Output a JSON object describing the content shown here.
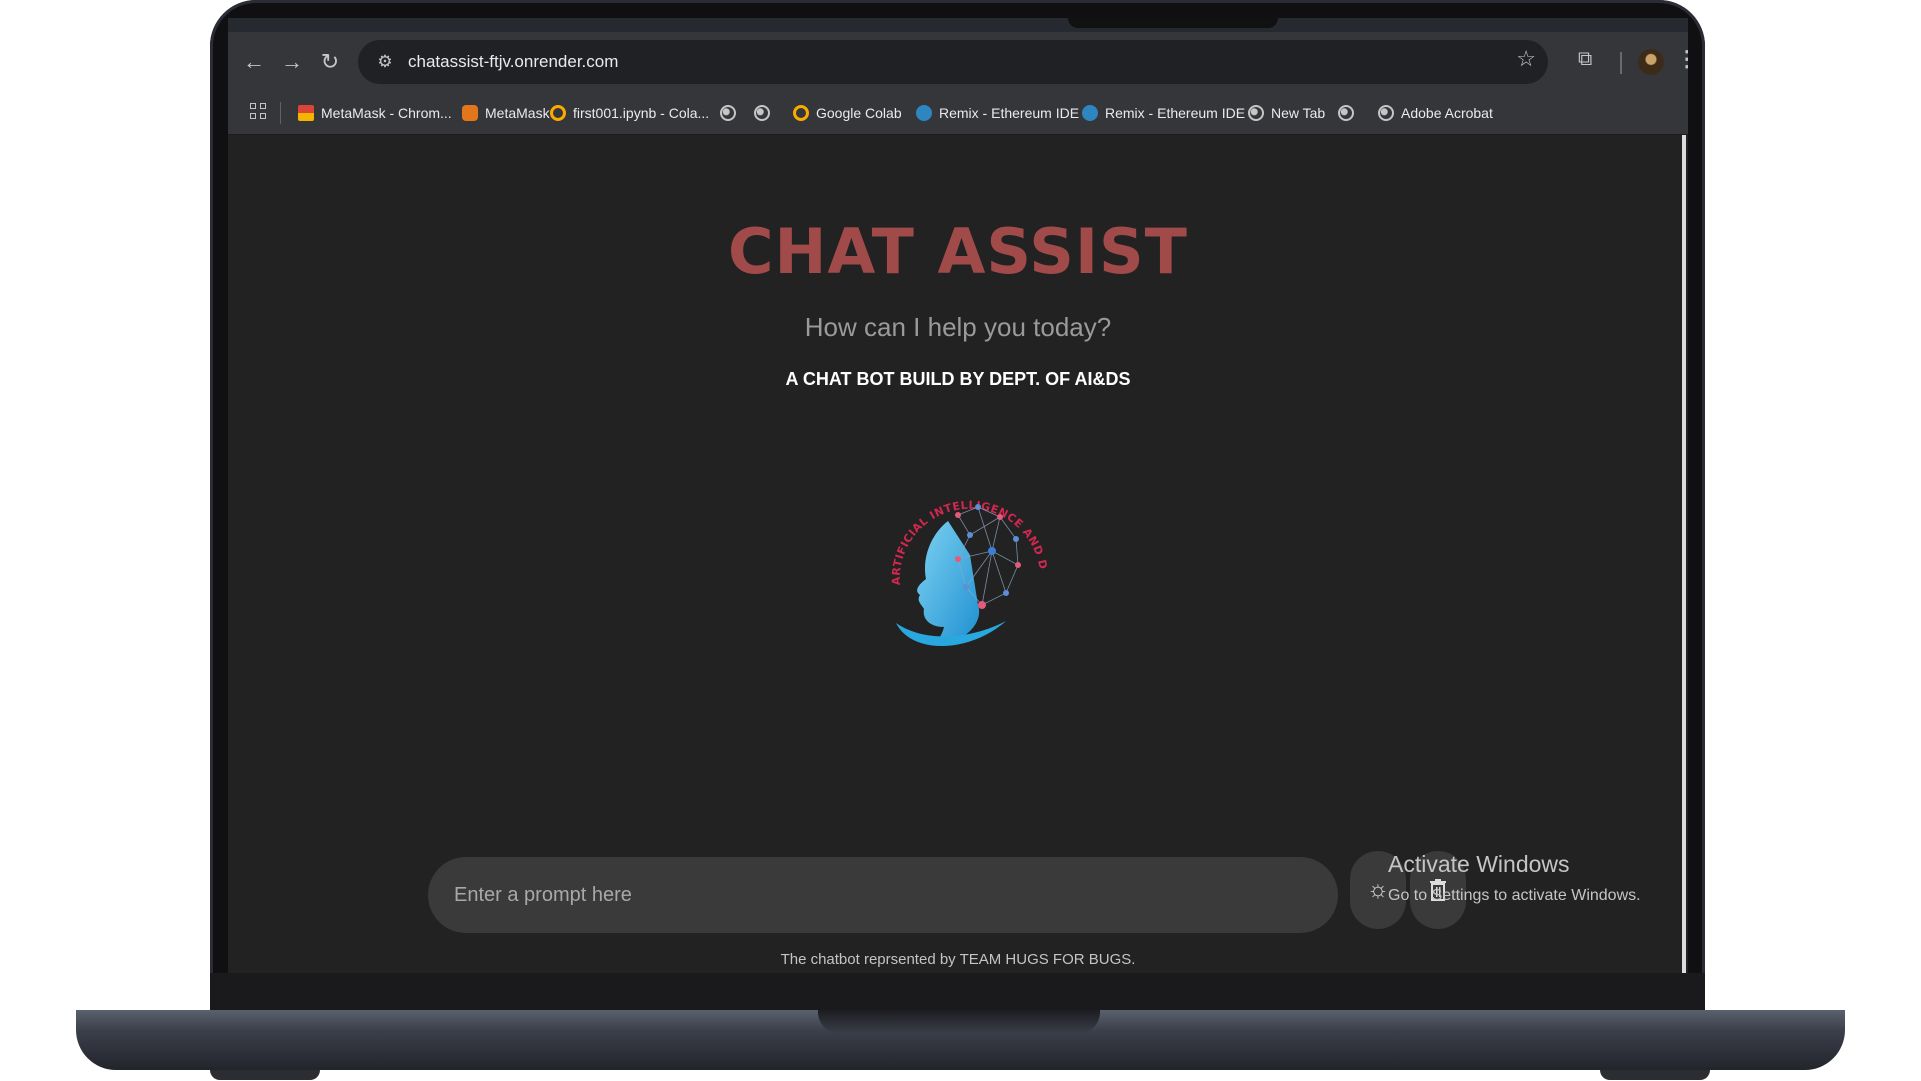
{
  "browser": {
    "url": "chatassist-ftjv.onrender.com",
    "bookmarks": [
      {
        "label": "MetaMask - Chrom...",
        "icon": "chrome-webstore-icon"
      },
      {
        "label": "MetaMask",
        "icon": "metamask-fox-icon"
      },
      {
        "label": "first001.ipynb - Cola...",
        "icon": "colab-icon"
      },
      {
        "label": "",
        "icon": "globe-icon"
      },
      {
        "label": "",
        "icon": "globe-icon"
      },
      {
        "label": "Google Colab",
        "icon": "colab-icon"
      },
      {
        "label": "Remix - Ethereum IDE",
        "icon": "remix-icon"
      },
      {
        "label": "Remix - Ethereum IDE",
        "icon": "remix-icon"
      },
      {
        "label": "New Tab",
        "icon": "globe-icon"
      },
      {
        "label": "",
        "icon": "globe-icon"
      },
      {
        "label": "Adobe Acrobat",
        "icon": "globe-icon"
      }
    ]
  },
  "page": {
    "title": "CHAT ASSIST",
    "subtitle": "How can I help you today?",
    "tagline": "A CHAT BOT BUILD BY DEPT. OF AI&DS",
    "logo_text": "ARTIFICIAL INTELLIGENCE AND DATA SCIENCE",
    "prompt_placeholder": "Enter a prompt here",
    "footer": "The chatbot reprsented by TEAM HUGS FOR BUGS."
  },
  "os_overlay": {
    "title": "Activate Windows",
    "subtitle": "Go to Settings to activate Windows."
  },
  "colors": {
    "title": "#a04a4a",
    "background": "#222222",
    "input": "#3a3a3a"
  }
}
